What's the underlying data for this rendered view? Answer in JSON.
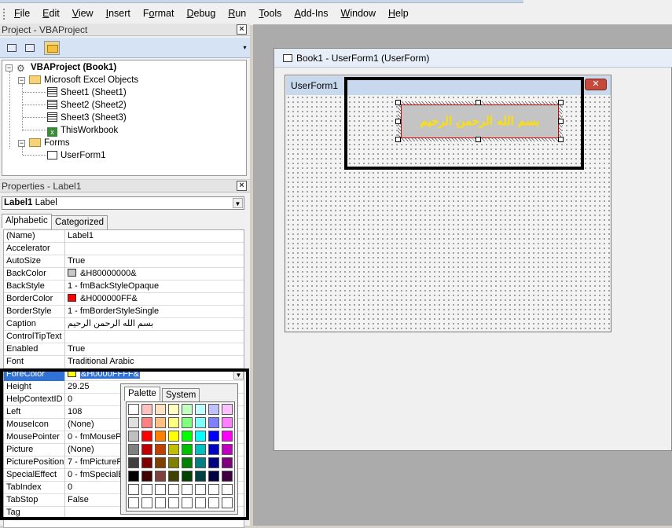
{
  "menu": [
    {
      "label": "File",
      "u": "F"
    },
    {
      "label": "Edit",
      "u": "E"
    },
    {
      "label": "View",
      "u": "V"
    },
    {
      "label": "Insert",
      "u": "I"
    },
    {
      "label": "Format",
      "u": "o"
    },
    {
      "label": "Debug",
      "u": "D"
    },
    {
      "label": "Run",
      "u": "R"
    },
    {
      "label": "Tools",
      "u": "T"
    },
    {
      "label": "Add-Ins",
      "u": "A"
    },
    {
      "label": "Window",
      "u": "W"
    },
    {
      "label": "Help",
      "u": "H"
    }
  ],
  "project": {
    "title": "Project - VBAProject",
    "close": "×",
    "tree": {
      "root": "VBAProject (Book1)",
      "excel_objects": "Microsoft Excel Objects",
      "sheet1": "Sheet1 (Sheet1)",
      "sheet2": "Sheet2 (Sheet2)",
      "sheet3": "Sheet3 (Sheet3)",
      "workbook": "ThisWorkbook",
      "forms": "Forms",
      "userform": "UserForm1"
    }
  },
  "properties": {
    "title": "Properties - Label1",
    "close": "×",
    "object_name": "Label1",
    "object_type": "Label",
    "tabs": {
      "alphabetic": "Alphabetic",
      "categorized": "Categorized"
    },
    "rows": [
      {
        "name": "(Name)",
        "value": "Label1"
      },
      {
        "name": "Accelerator",
        "value": ""
      },
      {
        "name": "AutoSize",
        "value": "True"
      },
      {
        "name": "BackColor",
        "value": "&H80000000&",
        "swatch": "#c8c8c8"
      },
      {
        "name": "BackStyle",
        "value": "1 - fmBackStyleOpaque"
      },
      {
        "name": "BorderColor",
        "value": "&H000000FF&",
        "swatch": "#ff0000"
      },
      {
        "name": "BorderStyle",
        "value": "1 - fmBorderStyleSingle"
      },
      {
        "name": "Caption",
        "value": "بسم الله الرحمن الرحيم"
      },
      {
        "name": "ControlTipText",
        "value": ""
      },
      {
        "name": "Enabled",
        "value": "True"
      },
      {
        "name": "Font",
        "value": "Traditional Arabic"
      },
      {
        "name": "ForeColor",
        "value": "&H0000FFFF&",
        "swatch": "#ffff00",
        "selected": true
      },
      {
        "name": "Height",
        "value": "29.25"
      },
      {
        "name": "HelpContextID",
        "value": "0"
      },
      {
        "name": "Left",
        "value": "108"
      },
      {
        "name": "MouseIcon",
        "value": "(None)"
      },
      {
        "name": "MousePointer",
        "value": "0 - fmMousePo"
      },
      {
        "name": "Picture",
        "value": "(None)"
      },
      {
        "name": "PicturePosition",
        "value": "7 - fmPicturePo"
      },
      {
        "name": "SpecialEffect",
        "value": "0 - fmSpecialEf"
      },
      {
        "name": "TabIndex",
        "value": "0"
      },
      {
        "name": "TabStop",
        "value": "False"
      },
      {
        "name": "Tag",
        "value": ""
      }
    ]
  },
  "palette": {
    "tabs": {
      "palette": "Palette",
      "system": "System"
    },
    "colors": [
      [
        "#ffffff",
        "#ffc0c0",
        "#ffe0c0",
        "#ffffc0",
        "#c0ffc0",
        "#c0ffff",
        "#c0c0ff",
        "#ffc0ff"
      ],
      [
        "#e0e0e0",
        "#ff8080",
        "#ffc080",
        "#ffff80",
        "#80ff80",
        "#80ffff",
        "#8080ff",
        "#ff80ff"
      ],
      [
        "#c0c0c0",
        "#ff0000",
        "#ff8000",
        "#ffff00",
        "#00ff00",
        "#00ffff",
        "#0000ff",
        "#ff00ff"
      ],
      [
        "#808080",
        "#c00000",
        "#c04000",
        "#c0c000",
        "#00c000",
        "#00c0c0",
        "#0000c0",
        "#c000c0"
      ],
      [
        "#404040",
        "#800000",
        "#804000",
        "#808000",
        "#008000",
        "#008080",
        "#000080",
        "#800080"
      ],
      [
        "#000000",
        "#400000",
        "#804040",
        "#404000",
        "#004000",
        "#004040",
        "#000040",
        "#400040"
      ],
      [
        "#ffffff",
        "#ffffff",
        "#ffffff",
        "#ffffff",
        "#ffffff",
        "#ffffff",
        "#ffffff",
        "#ffffff"
      ],
      [
        "#ffffff",
        "#ffffff",
        "#ffffff",
        "#ffffff",
        "#ffffff",
        "#ffffff",
        "#ffffff",
        "#ffffff"
      ]
    ]
  },
  "code_window": {
    "title": "Book1 - UserForm1 (UserForm)"
  },
  "userform": {
    "title": "UserForm1",
    "close": "✕",
    "label_caption": "بسم الله الرحمن الرحيم",
    "label_forecolor": "#ffe000"
  }
}
